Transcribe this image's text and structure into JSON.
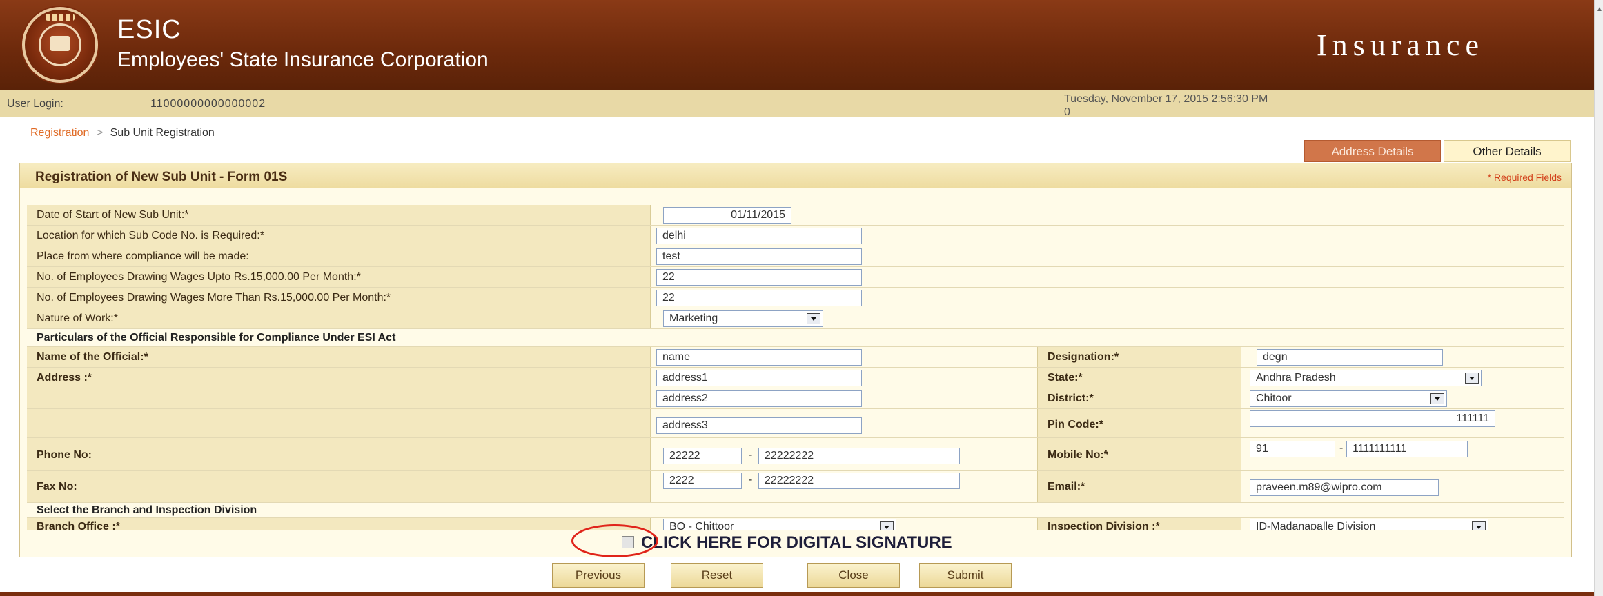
{
  "header": {
    "org_short": "ESIC",
    "org_full": "Employees' State Insurance Corporation",
    "brand_word": "Insurance",
    "logo_icon": "esic-emblem-icon"
  },
  "login_bar": {
    "label": "User Login:",
    "user_id": "11000000000000002",
    "datetime_line1": "Tuesday, November 17, 2015 2:56:30 PM",
    "datetime_line2": "0"
  },
  "breadcrumb": {
    "link": "Registration",
    "separator": ">",
    "current": "Sub Unit Registration"
  },
  "tabs": [
    {
      "label": "Address Details",
      "active": true
    },
    {
      "label": "Other Details",
      "active": false
    }
  ],
  "form": {
    "title": "Registration of New Sub Unit - Form 01S",
    "required_note": "* Required Fields",
    "fields": {
      "start_date": {
        "label": "Date of Start of New Sub Unit:*",
        "value": "01/11/2015"
      },
      "location": {
        "label": "Location for which Sub Code No. is Required:*",
        "value": "delhi"
      },
      "compliance_place": {
        "label": "Place from where compliance will be made:",
        "value": "test"
      },
      "emp_upto": {
        "label": "No. of Employees Drawing Wages Upto Rs.15,000.00 Per Month:*",
        "value": "22"
      },
      "emp_more": {
        "label": "No. of Employees Drawing Wages More Than Rs.15,000.00 Per Month:*",
        "value": "22"
      },
      "nature_of_work": {
        "label": "Nature of Work:*",
        "value": "Marketing"
      }
    },
    "section_official": "Particulars of the Official Responsible for Compliance Under ESI Act",
    "official": {
      "name_label": "Name of the Official:*",
      "name_value": "name",
      "designation_label": "Designation:*",
      "designation_value": "degn",
      "address_label": "Address :*",
      "address1": "address1",
      "address2": "address2",
      "address3": "address3",
      "state_label": "State:*",
      "state_value": "Andhra Pradesh",
      "district_label": "District:*",
      "district_value": "Chitoor",
      "pin_label": "Pin Code:*",
      "pin_value": "111111",
      "phone_label": "Phone No:",
      "phone_code": "22222",
      "phone_number": "22222222",
      "mobile_label": "Mobile No:*",
      "mobile_code": "91",
      "mobile_number": "1111111111",
      "fax_label": "Fax No:",
      "fax_code": "2222",
      "fax_number": "22222222",
      "email_label": "Email:*",
      "email_value": "praveen.m89@wipro.com",
      "dash": "-"
    },
    "section_branch": "Select the Branch and Inspection Division",
    "branch": {
      "branch_label": "Branch Office :*",
      "branch_value": "BO - Chittoor",
      "division_label": "Inspection Division :*",
      "division_value": "ID-Madanapalle Division"
    },
    "signature_label": "CLICK HERE FOR DIGITAL SIGNATURE"
  },
  "buttons": {
    "previous": "Previous",
    "reset": "Reset",
    "close": "Close",
    "submit": "Submit"
  },
  "colors": {
    "header_brown": "#6e2a0c",
    "login_bar": "#e8d9a6",
    "active_tab": "#d1764a",
    "required_red": "#d2401a",
    "annotation_circle": "#e0241a"
  }
}
